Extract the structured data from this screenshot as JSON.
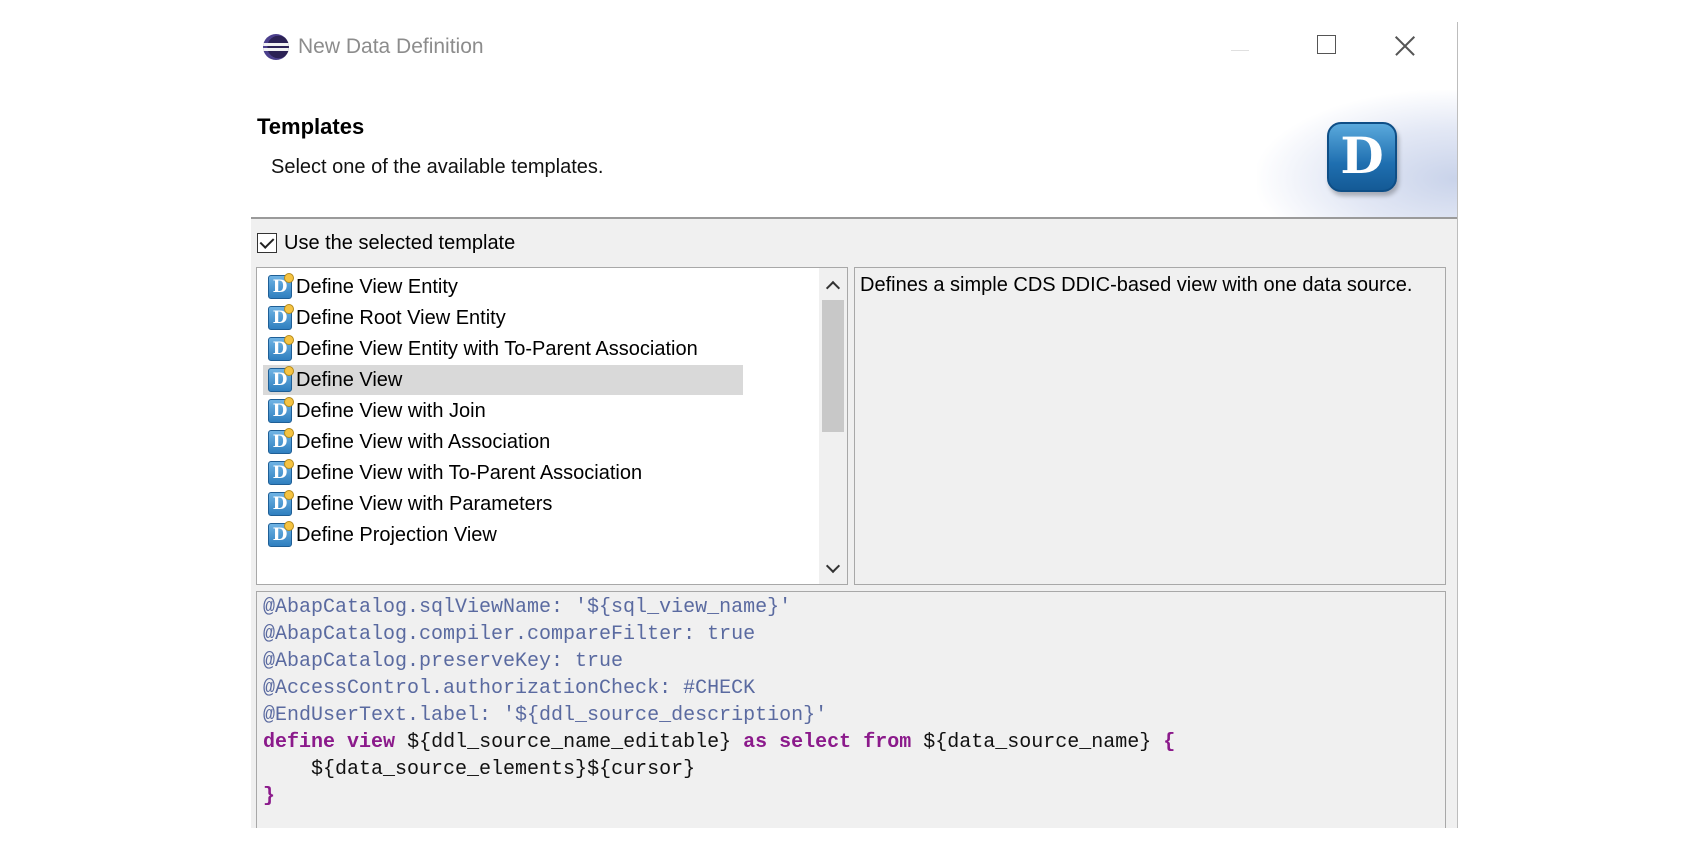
{
  "window": {
    "title": "New Data Definition"
  },
  "header": {
    "title": "Templates",
    "subtitle": "Select one of the available templates.",
    "logo_letter": "D"
  },
  "use_template": {
    "label": "Use the selected template",
    "checked": true
  },
  "templates": {
    "items": [
      {
        "label": "Define View Entity",
        "selected": false
      },
      {
        "label": "Define Root View Entity",
        "selected": false
      },
      {
        "label": "Define View Entity with To-Parent Association",
        "selected": false
      },
      {
        "label": "Define View",
        "selected": true
      },
      {
        "label": "Define View with Join",
        "selected": false
      },
      {
        "label": "Define View with Association",
        "selected": false
      },
      {
        "label": "Define View with To-Parent Association",
        "selected": false
      },
      {
        "label": "Define View with Parameters",
        "selected": false
      },
      {
        "label": "Define Projection View",
        "selected": false
      }
    ],
    "icon_letter": "D"
  },
  "description": "Defines a simple CDS DDIC-based view with one data source.",
  "code": {
    "lines": [
      "@AbapCatalog.sqlViewName: '${sql_view_name}'",
      "@AbapCatalog.compiler.compareFilter: true",
      "@AbapCatalog.preserveKey: true",
      "@AccessControl.authorizationCheck: #CHECK",
      "@EndUserText.label: '${ddl_source_description}'",
      "define view ${ddl_source_name_editable} as select from ${data_source_name} {",
      "    ${data_source_elements}${cursor}",
      "}"
    ],
    "define_line": {
      "kw_define": "define",
      "kw_view": "view",
      "var_source": "${ddl_source_name_editable}",
      "kw_as": "as",
      "kw_select": "select",
      "kw_from": "from",
      "var_data": "${data_source_name}",
      "brace_open": "{"
    },
    "body_line": {
      "vars": "${data_source_elements}",
      "cursor": "${cursor}"
    },
    "brace_close": "}"
  },
  "colors": {
    "annotation": "#5a6aa0",
    "keyword": "#8b1a8b",
    "selection": "#d9d9d9",
    "background": "#f0f0f0"
  }
}
